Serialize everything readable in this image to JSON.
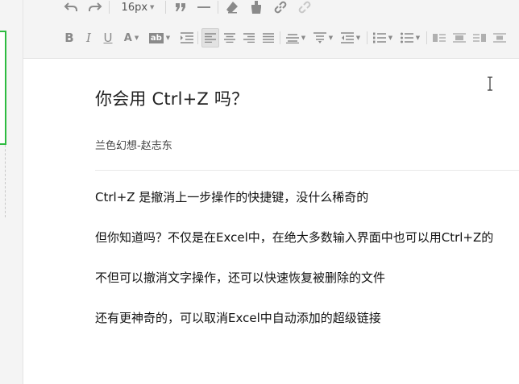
{
  "toolbar": {
    "font_size": "16px"
  },
  "document": {
    "title": "你会用 Ctrl+Z 吗？",
    "author": "兰色幻想-赵志东",
    "paragraphs": [
      "Ctrl+Z 是撤消上一步操作的快捷键，没什么稀奇的",
      "但你知道吗？不仅是在Excel中，在绝大多数输入界面中也可以用Ctrl+Z的",
      "不但可以撤消文字操作，还可以快速恢复被删除的文件",
      "还有更神奇的，可以取消Excel中自动添加的超级链接"
    ]
  },
  "colors": {
    "accent_green": "#2dbb40",
    "toolbar_bg": "#f4f4f4",
    "icon_gray": "#8a8a8a"
  }
}
